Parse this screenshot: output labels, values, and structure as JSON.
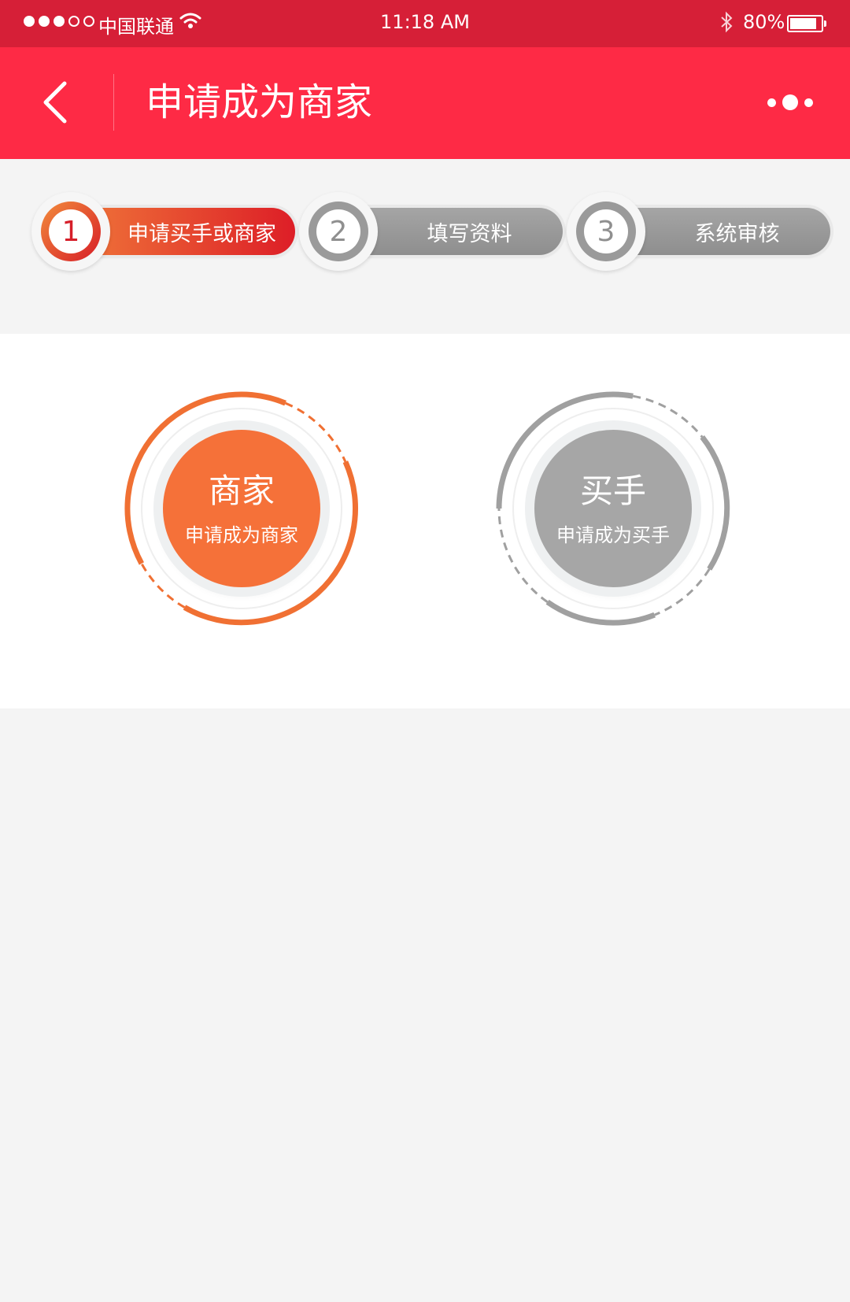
{
  "status_bar": {
    "carrier": "中国联通",
    "time": "11:18 AM",
    "battery": "80%",
    "battery_level": 0.8
  },
  "nav": {
    "title": "申请成为商家",
    "back_icon": "chevron-left-icon",
    "more_icon": "more-dots-icon"
  },
  "steps": [
    {
      "number": "1",
      "label": "申请买手或商家",
      "active": true
    },
    {
      "number": "2",
      "label": "填写资料",
      "active": false
    },
    {
      "number": "3",
      "label": "系统审核",
      "active": false
    }
  ],
  "roles": [
    {
      "title": "商家",
      "subtitle": "申请成为商家",
      "color": "#f57139"
    },
    {
      "title": "买手",
      "subtitle": "申请成为买手",
      "color": "#a6a6a6"
    }
  ],
  "colors": {
    "status_bar_bg": "#d61f37",
    "nav_bg": "#fe2a45",
    "active_orange": "#f57139",
    "inactive_gray": "#a6a6a6"
  }
}
